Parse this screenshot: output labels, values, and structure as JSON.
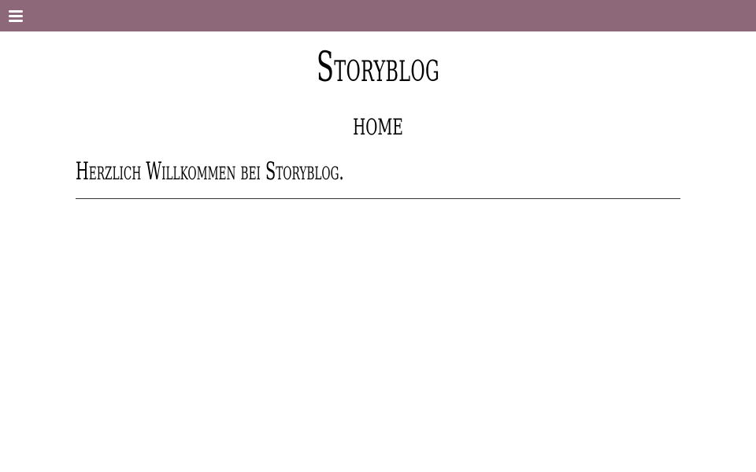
{
  "header": {
    "menu_icon": "hamburger-menu-icon",
    "background_color": "#8c6878"
  },
  "site": {
    "title": "Storyblog"
  },
  "page": {
    "heading": "home",
    "welcome": "Herzlich Willkommen bei Storyblog."
  }
}
